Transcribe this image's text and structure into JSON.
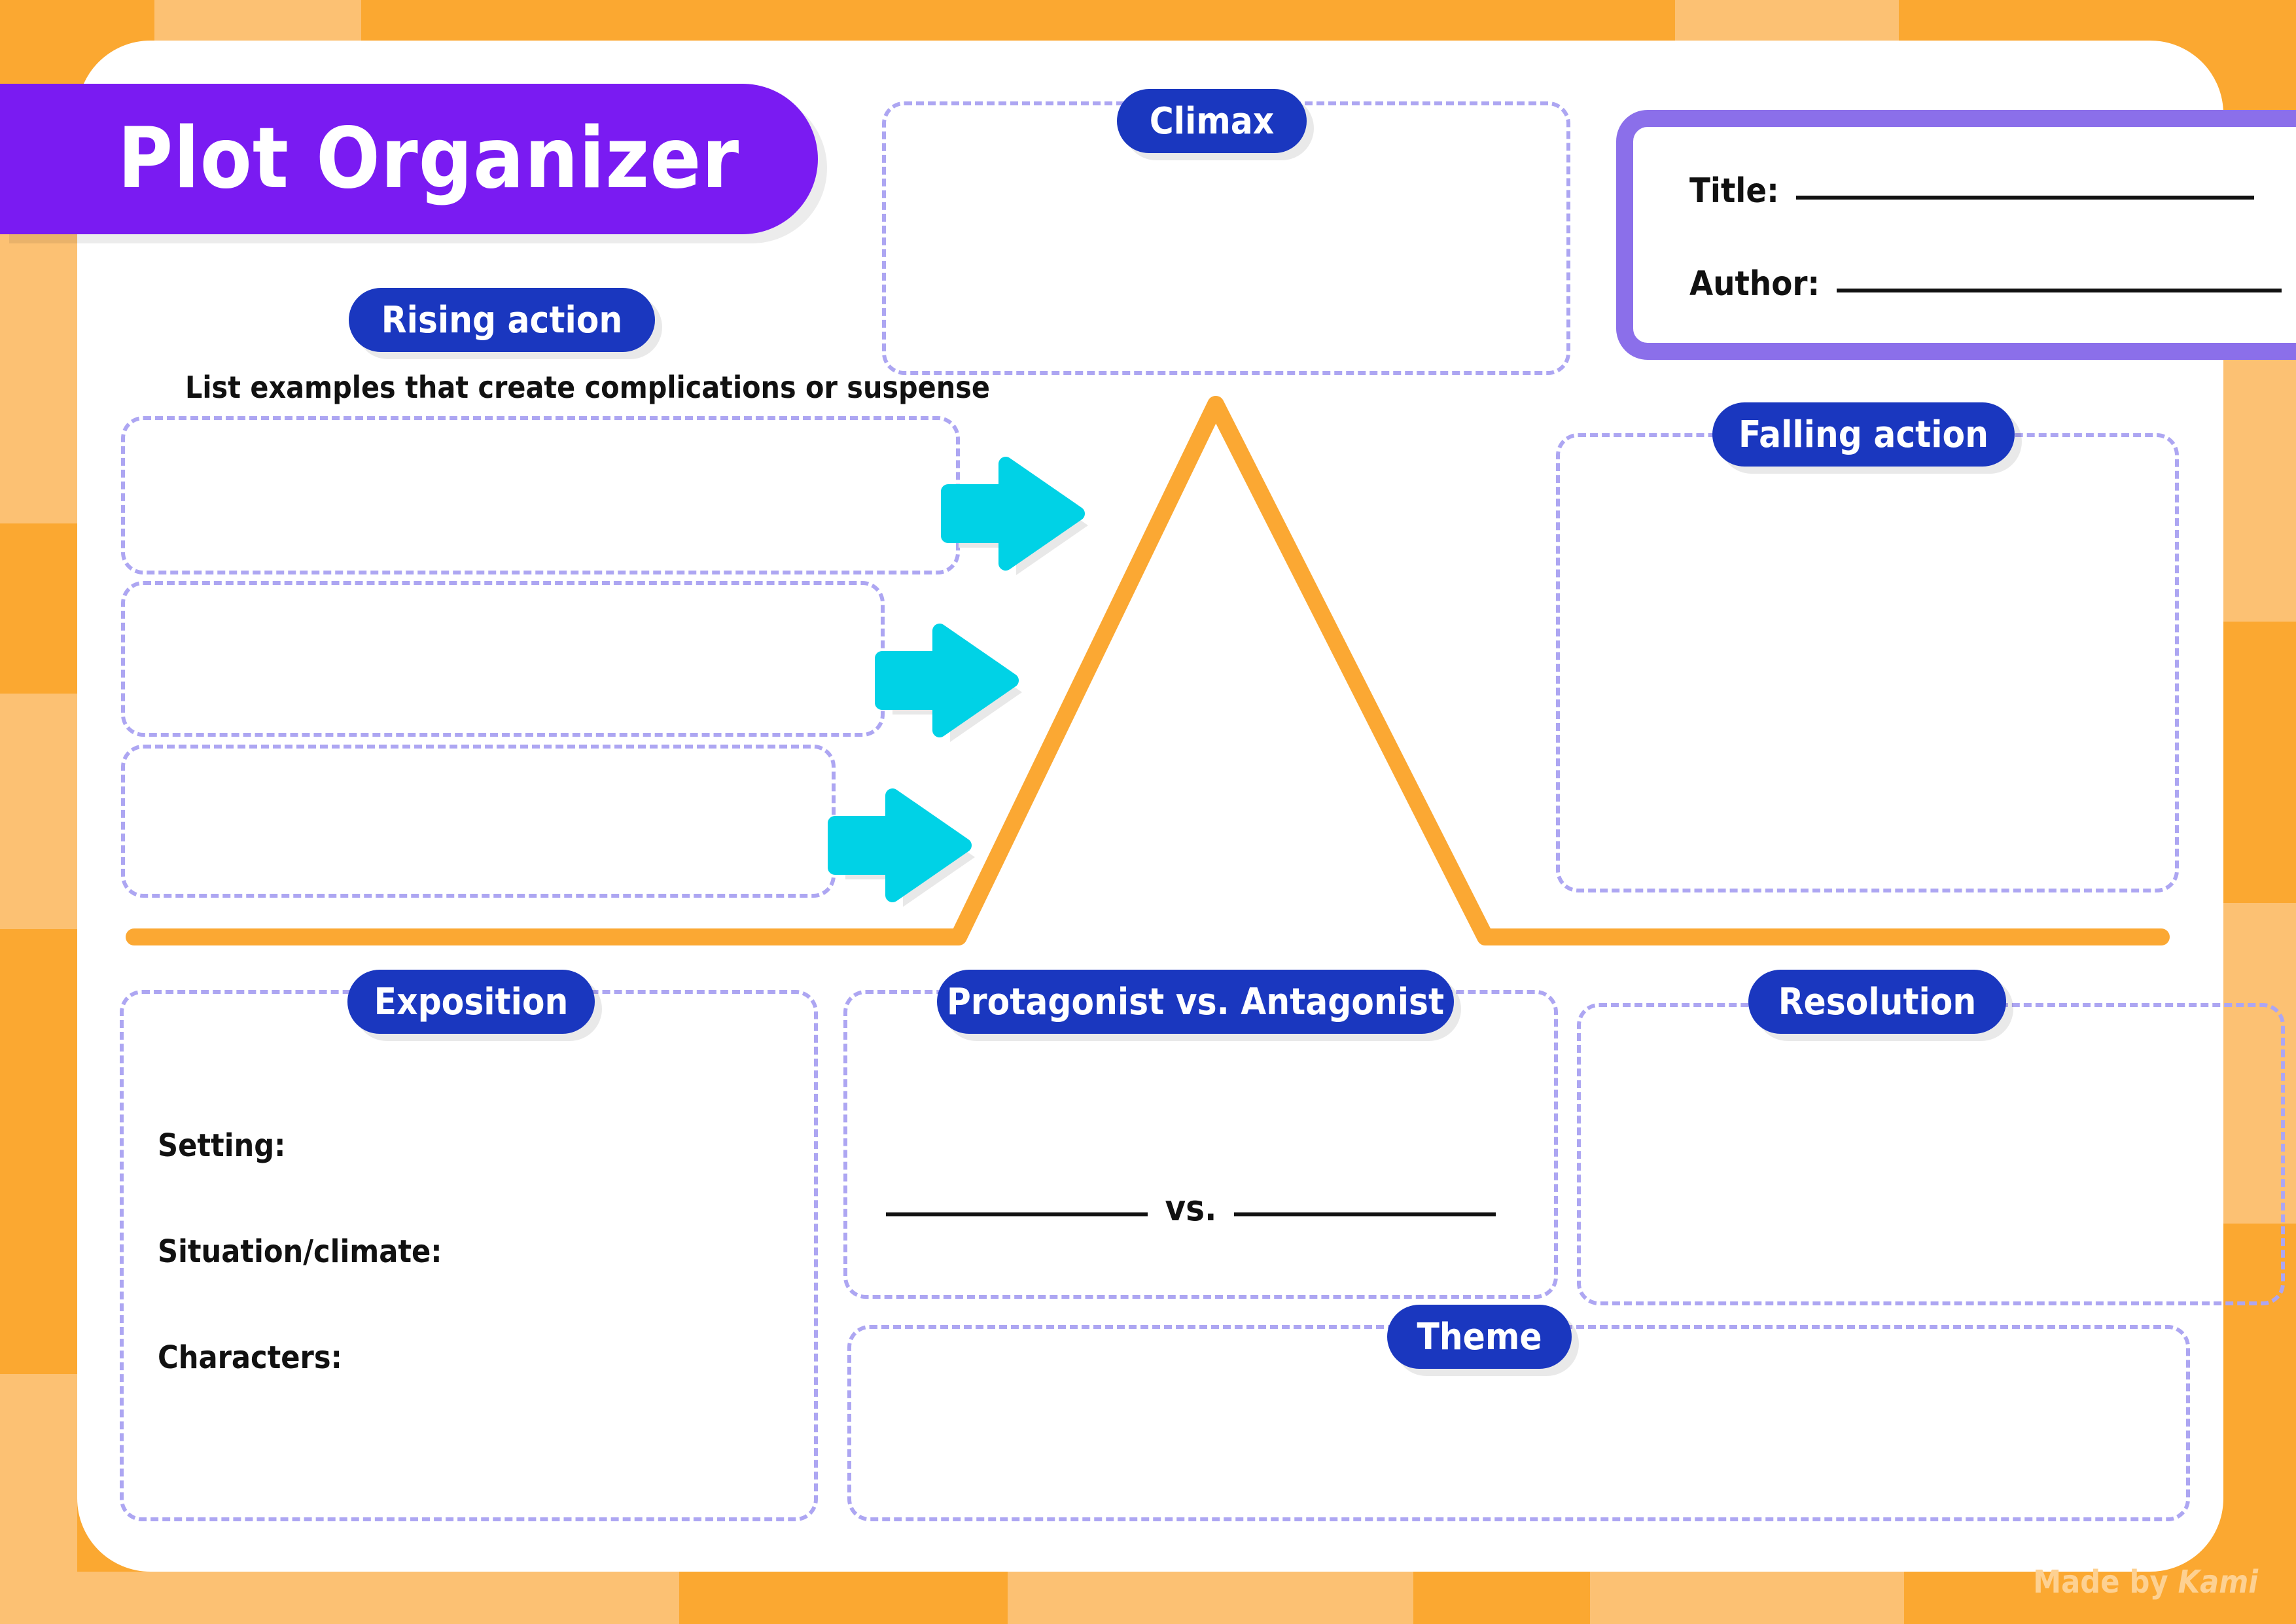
{
  "page": {
    "title": "Plot Organizer",
    "watermark_prefix": "Made by ",
    "watermark_brand": "Kami"
  },
  "colors": {
    "background_orange_dark": "#FBA831",
    "background_orange_light": "#FCC173",
    "card_white": "#FFFFFF",
    "banner_purple": "#7A1BF2",
    "pill_blue": "#1A37BF",
    "dashed_lavender": "#ADA6F2",
    "arrow_cyan": "#00D2E6",
    "plotline_orange": "#FBA833",
    "titlebox_border_purple": "#8B6FEA",
    "watermark_text": "#FDD192",
    "ink_black": "#111111"
  },
  "title_author_box": {
    "title_label": "Title:",
    "author_label": "Author:"
  },
  "sections": {
    "rising_action": {
      "pill_label": "Rising action",
      "instruction": "List examples that create complications or suspense",
      "boxes": [
        "",
        "",
        ""
      ]
    },
    "climax": {
      "pill_label": "Climax",
      "box_value": ""
    },
    "falling_action": {
      "pill_label": "Falling action",
      "box_value": ""
    },
    "exposition": {
      "pill_label": "Exposition",
      "fields": [
        {
          "label": "Setting:",
          "value": ""
        },
        {
          "label": "Situation/climate:",
          "value": ""
        },
        {
          "label": "Characters:",
          "value": ""
        }
      ]
    },
    "protagonist_vs_antagonist": {
      "pill_label": "Protagonist vs. Antagonist",
      "vs_label": "vs.",
      "left_blank": "",
      "right_blank": ""
    },
    "resolution": {
      "pill_label": "Resolution",
      "box_value": ""
    },
    "theme": {
      "pill_label": "Theme",
      "box_value": ""
    }
  },
  "icons": {
    "arrow_right_1": "arrow-right-icon",
    "arrow_right_2": "arrow-right-icon",
    "arrow_right_3": "arrow-right-icon",
    "plot_mountain": "plot-diagram-line"
  }
}
